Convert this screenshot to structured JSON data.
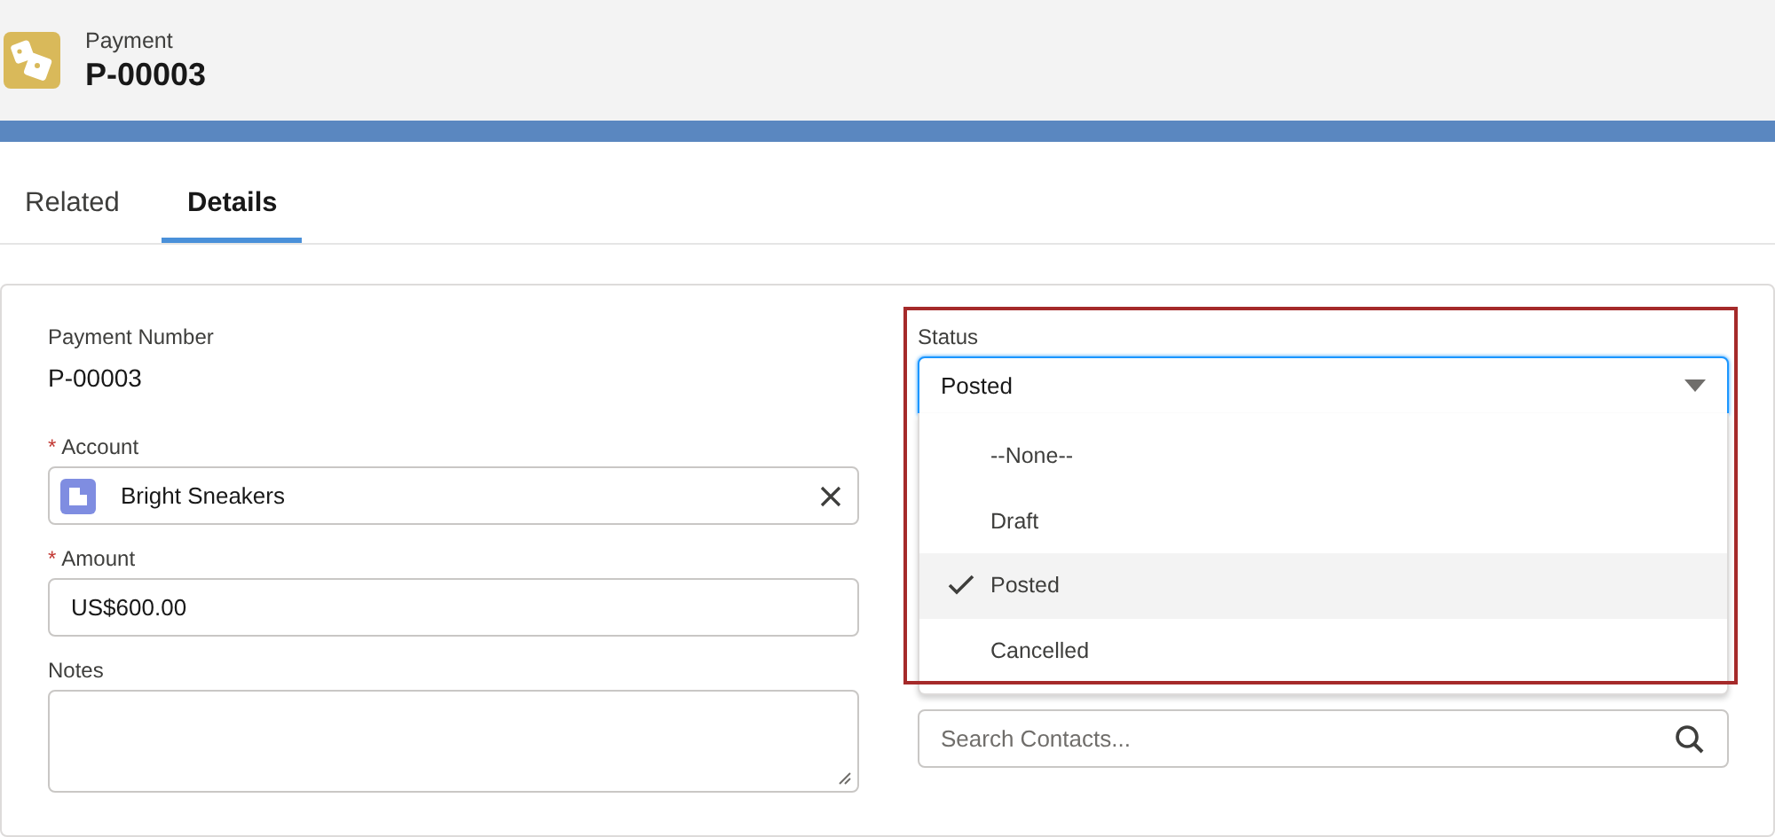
{
  "header": {
    "object_type": "Payment",
    "record_name": "P-00003"
  },
  "tabs": [
    {
      "label": "Related",
      "selected": false
    },
    {
      "label": "Details",
      "selected": true
    }
  ],
  "left_fields": [
    {
      "kind": "readonly",
      "label": "Payment Number",
      "value": "P-00003"
    },
    {
      "kind": "lookup",
      "label": "Account",
      "required_mark": "*",
      "value": "Bright Sneakers"
    },
    {
      "kind": "text",
      "label": "Amount",
      "required_mark": "*",
      "value": "US$600.00"
    },
    {
      "kind": "textarea",
      "label": "Notes"
    }
  ],
  "status": {
    "label": "Status",
    "value": "Posted",
    "options": [
      {
        "label": "--None--",
        "selected": false
      },
      {
        "label": "Draft",
        "selected": false
      },
      {
        "label": "Posted",
        "selected": true
      },
      {
        "label": "Cancelled",
        "selected": false
      }
    ]
  },
  "paid_by": {
    "placeholder": "Search Contacts..."
  }
}
